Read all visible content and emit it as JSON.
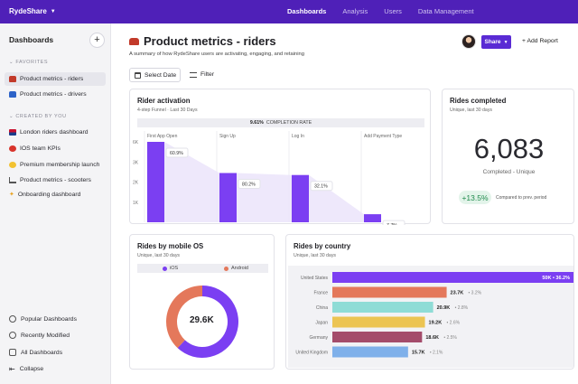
{
  "topbar": {
    "brand": "RydeShare",
    "nav": [
      {
        "label": "Dashboards",
        "active": true
      },
      {
        "label": "Analysis",
        "active": false
      },
      {
        "label": "Users",
        "active": false
      },
      {
        "label": "Data Management",
        "active": false
      }
    ],
    "accent": "#4f20b8"
  },
  "sidebar": {
    "title": "Dashboards",
    "favorites_label": "FAVORITES",
    "favorites": [
      {
        "label": "Product metrics - riders",
        "icon": "car-red-icon",
        "active": true
      },
      {
        "label": "Product metrics - drivers",
        "icon": "car-blue-icon",
        "active": false
      }
    ],
    "created_label": "CREATED BY YOU",
    "created": [
      {
        "label": "London riders dashboard",
        "icon": "uk-flag-icon"
      },
      {
        "label": "IOS team KPIs",
        "icon": "red-circle-icon"
      },
      {
        "label": "Premium membership launch",
        "icon": "smile-icon"
      },
      {
        "label": "Product metrics - scooters",
        "icon": "scooter-icon"
      },
      {
        "label": "Onboarding dashboard",
        "icon": "party-icon"
      }
    ],
    "footer": [
      {
        "label": "Popular Dashboards",
        "icon": "popular-icon"
      },
      {
        "label": "Recently Modified",
        "icon": "clock-icon"
      },
      {
        "label": "All Dashboards",
        "icon": "folder-icon"
      },
      {
        "label": "Collapse",
        "icon": "collapse-icon"
      }
    ]
  },
  "header": {
    "title": "Product metrics - riders",
    "subtitle": "A summary of how RydeShare users are activating, engaging, and retaining",
    "share_label": "Share",
    "add_report_label": "Add Report",
    "date_label": "Select Date",
    "filter_label": "Filter"
  },
  "rider_activation": {
    "title": "Rider activation",
    "subtitle": "4-step Funnel · Last 30 Days",
    "completion_value": "9.61%",
    "completion_label": "COMPLETION RATE"
  },
  "rides_completed": {
    "title": "Rides completed",
    "subtitle": "Unique, last 30 days",
    "value": "6,083",
    "label": "Completed - Unique",
    "change": "+13.5%",
    "change_note": "Compared to prev. period"
  },
  "rides_by_os": {
    "title": "Rides by mobile OS",
    "subtitle": "Unique, last 30 days",
    "center_label": "29.6K"
  },
  "rides_by_country": {
    "title": "Rides by country",
    "subtitle": "Unique, last 30 days"
  },
  "chart_data": [
    {
      "type": "bar",
      "id": "funnel",
      "categories": [
        "First App Open",
        "Sign Up",
        "Log In",
        "Add Payment Type"
      ],
      "values": [
        8000,
        4900,
        4700,
        800
      ],
      "step_conversion_labels": [
        "60.9%",
        "80.2%",
        "32.1%",
        "7.7%"
      ],
      "y_ticks": [
        "6K",
        "3K",
        "2K",
        "1K"
      ],
      "bar_color": "#7b3ff2"
    },
    {
      "type": "pie",
      "id": "os",
      "series": [
        {
          "name": "iOS",
          "value": 62,
          "color": "#7b3ff2"
        },
        {
          "name": "Android",
          "value": 38,
          "color": "#e4785b"
        }
      ]
    },
    {
      "type": "bar",
      "id": "country",
      "categories": [
        "United States",
        "France",
        "China",
        "Japan",
        "Germany",
        "United Kingdom"
      ],
      "values": [
        50,
        23.7,
        20.9,
        19.2,
        18.6,
        15.7
      ],
      "value_labels": [
        "50K",
        "23.7K",
        "20.9K",
        "19.2K",
        "18.6K",
        "15.7K"
      ],
      "pct_labels": [
        "36.2%",
        "3.2%",
        "2.8%",
        "2.6%",
        "2.5%",
        "2.1%"
      ],
      "colors": [
        "#7b3ff2",
        "#e4785b",
        "#8fdcd6",
        "#ecc452",
        "#a44c6b",
        "#7fb0ea"
      ],
      "xlim": [
        0,
        50
      ]
    }
  ]
}
